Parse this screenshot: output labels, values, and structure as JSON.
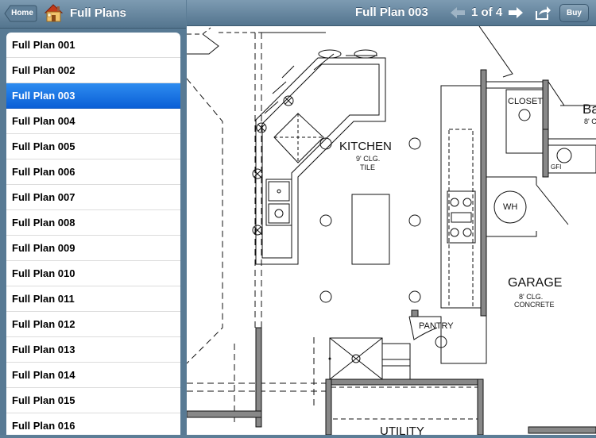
{
  "sidebar": {
    "home_label": "Home",
    "title": "Full Plans",
    "items": [
      {
        "label": "Full Plan 001"
      },
      {
        "label": "Full Plan 002"
      },
      {
        "label": "Full Plan 003",
        "selected": true
      },
      {
        "label": "Full Plan 004"
      },
      {
        "label": "Full Plan 005"
      },
      {
        "label": "Full Plan 006"
      },
      {
        "label": "Full Plan 007"
      },
      {
        "label": "Full Plan 008"
      },
      {
        "label": "Full Plan 009"
      },
      {
        "label": "Full Plan 010"
      },
      {
        "label": "Full Plan 011"
      },
      {
        "label": "Full Plan 012"
      },
      {
        "label": "Full Plan 013"
      },
      {
        "label": "Full Plan 014"
      },
      {
        "label": "Full Plan 015"
      },
      {
        "label": "Full Plan 016"
      }
    ]
  },
  "toolbar": {
    "title": "Full Plan 003",
    "page_indicator": "1 of 4",
    "buy_label": "Buy",
    "prev_icon": "left-arrow-icon",
    "next_icon": "right-arrow-icon",
    "share_icon": "share-icon"
  },
  "floor_plan": {
    "kitchen": "KITCHEN",
    "kitchen_ceiling": "9' CLG.",
    "kitchen_floor": "TILE",
    "closet": "CLOSET",
    "bath_partial": "Ba",
    "bath_ceiling_partial": "8' C",
    "gfi": "GFI",
    "water_heater": "WH",
    "garage": "GARAGE",
    "garage_ceiling": "8' CLG.",
    "garage_floor": "CONCRETE",
    "pantry": "PANTRY",
    "utility": "UTILITY"
  },
  "colors": {
    "bar": "#6a8aa3",
    "selection": "#1a73e8",
    "plan_line": "#111111"
  }
}
